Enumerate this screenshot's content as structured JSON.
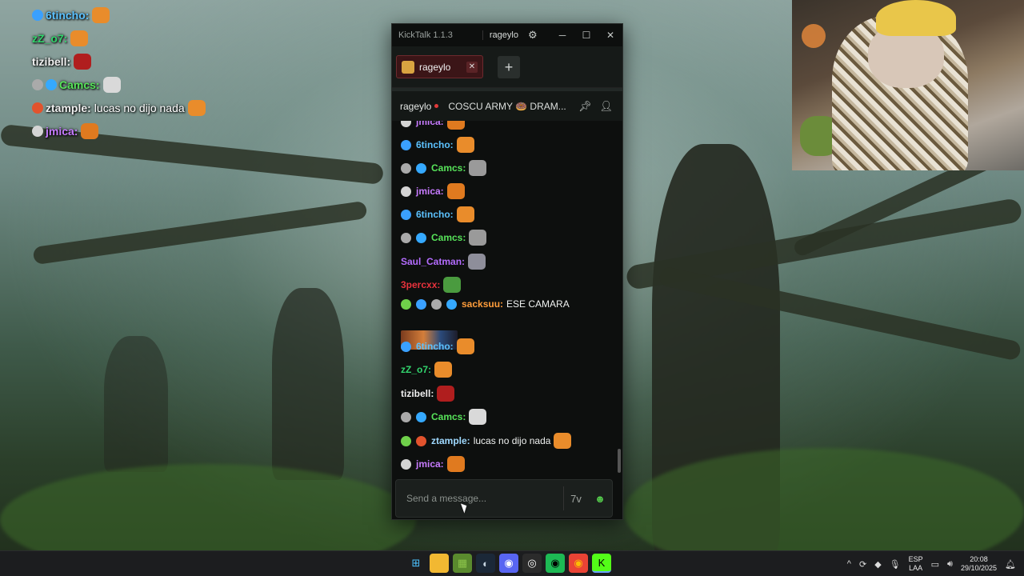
{
  "overlay": {
    "lines": [
      {
        "user": "6tincho:",
        "color": "#5cc2ff",
        "msg": "",
        "badges": [
          "#3aa0ff"
        ],
        "emote": "#e98c2b"
      },
      {
        "user": "zZ_o7:",
        "color": "#32d46d",
        "msg": "",
        "badges": [],
        "emote": "#e98c2b"
      },
      {
        "user": "tizibell:",
        "color": "#f0f0f0",
        "msg": "",
        "badges": [],
        "emote": "#b01e1e"
      },
      {
        "user": "Camcs:",
        "color": "#57e35a",
        "msg": "",
        "badges": [
          "#aaaaaa",
          "#35a9ff"
        ],
        "emote": "#d9d9d9"
      },
      {
        "user": "ztample:",
        "color": "#f0f0f0",
        "msg": "lucas no dijo nada",
        "badges": [
          "#e2532d"
        ],
        "emote": "#e98c2b"
      },
      {
        "user": "jmica:",
        "color": "#c77bff",
        "msg": "",
        "badges": [
          "#d4d4d4"
        ],
        "emote": "#e07a1f"
      }
    ]
  },
  "window": {
    "app_title": "KickTalk 1.1.3",
    "current_user": "rageylo",
    "minimize": "─",
    "maximize": "☐",
    "close": "✕",
    "gear": "⚙"
  },
  "tabs": [
    {
      "label": "rageylo",
      "close": "✕"
    }
  ],
  "add_tab": "+",
  "info": {
    "channel": "rageylo",
    "stream_title": "COSCU ARMY 🍩 DRAM..."
  },
  "chat": [
    {
      "user": "jmica:",
      "color": "#c77bff",
      "text": "",
      "badges": [
        "#d4d4d4"
      ],
      "emote": "#e07a1f"
    },
    {
      "user": "6tincho:",
      "color": "#5cc2ff",
      "text": "",
      "badges": [
        "#3aa0ff"
      ],
      "emote": "#e98c2b"
    },
    {
      "user": "Camcs:",
      "color": "#57e35a",
      "text": "",
      "badges": [
        "#aaaaaa",
        "#35a9ff"
      ],
      "emote": "#9a9a9a"
    },
    {
      "user": "jmica:",
      "color": "#c77bff",
      "text": "",
      "badges": [
        "#d4d4d4"
      ],
      "emote": "#e07a1f"
    },
    {
      "user": "6tincho:",
      "color": "#5cc2ff",
      "text": "",
      "badges": [
        "#3aa0ff"
      ],
      "emote": "#e98c2b"
    },
    {
      "user": "Camcs:",
      "color": "#57e35a",
      "text": "",
      "badges": [
        "#aaaaaa",
        "#35a9ff"
      ],
      "emote": "#9a9a9a"
    },
    {
      "user": "Saul_Catman:",
      "color": "#b46cff",
      "text": "",
      "badges": [],
      "emote": "#8e8e9a"
    },
    {
      "user": "3percxx:",
      "color": "#e8323c",
      "text": "",
      "badges": [],
      "emote": "#4a9b3f"
    },
    {
      "user": "sacksuu:",
      "color": "#ff9d3b",
      "text": "ESE CAMARA",
      "badges": [
        "#6fd04a",
        "#3aa0ff",
        "#aaaaaa",
        "#35a9ff"
      ],
      "emote": ""
    },
    {
      "user": "6tincho:",
      "color": "#5cc2ff",
      "text": "",
      "badges": [
        "#3aa0ff"
      ],
      "emote": "#e98c2b"
    },
    {
      "user": "zZ_o7:",
      "color": "#32d46d",
      "text": "",
      "badges": [],
      "emote": "#e98c2b"
    },
    {
      "user": "tizibell:",
      "color": "#f0f0f0",
      "text": "",
      "badges": [],
      "emote": "#b01e1e"
    },
    {
      "user": "Camcs:",
      "color": "#57e35a",
      "text": "",
      "badges": [
        "#aaaaaa",
        "#35a9ff"
      ],
      "emote": "#d9d9d9"
    },
    {
      "user": "ztample:",
      "color": "#9fd9ff",
      "text": "lucas no dijo nada",
      "badges": [
        "#6fd04a",
        "#e2532d"
      ],
      "emote": "#e98c2b"
    },
    {
      "user": "jmica:",
      "color": "#c77bff",
      "text": "",
      "badges": [
        "#d4d4d4"
      ],
      "emote": "#e07a1f"
    }
  ],
  "composer": {
    "placeholder": "Send a message...",
    "translate_icon": "7v",
    "emote_icon": "☻"
  },
  "taskbar": {
    "apps": [
      {
        "name": "windows-start-icon",
        "glyph": "⊞",
        "bg": "#1c1d1f",
        "fg": "#4cc2ff"
      },
      {
        "name": "file-explorer-icon",
        "glyph": "▬",
        "bg": "#f2b832",
        "fg": "#f2b832"
      },
      {
        "name": "minecraft-icon",
        "glyph": "▦",
        "bg": "#5a8a2e",
        "fg": "#8bc34a"
      },
      {
        "name": "steam-icon",
        "glyph": "◐",
        "bg": "#1b2838",
        "fg": "#c7d5e0"
      },
      {
        "name": "discord-icon",
        "glyph": "◉",
        "bg": "#5865f2",
        "fg": "#ffffff"
      },
      {
        "name": "obs-icon",
        "glyph": "◎",
        "bg": "#2b2b2b",
        "fg": "#ffffff"
      },
      {
        "name": "spotify-icon",
        "glyph": "◉",
        "bg": "#1db954",
        "fg": "#000000"
      },
      {
        "name": "chrome-icon",
        "glyph": "◉",
        "bg": "#ea4335",
        "fg": "#fbbc05"
      },
      {
        "name": "kick-icon",
        "glyph": "K",
        "bg": "#53fc18",
        "fg": "#000000"
      }
    ],
    "lang_top": "ESP",
    "lang_bottom": "LAA",
    "time": "20:08",
    "date": "29/10/2025",
    "chevron": "^"
  }
}
